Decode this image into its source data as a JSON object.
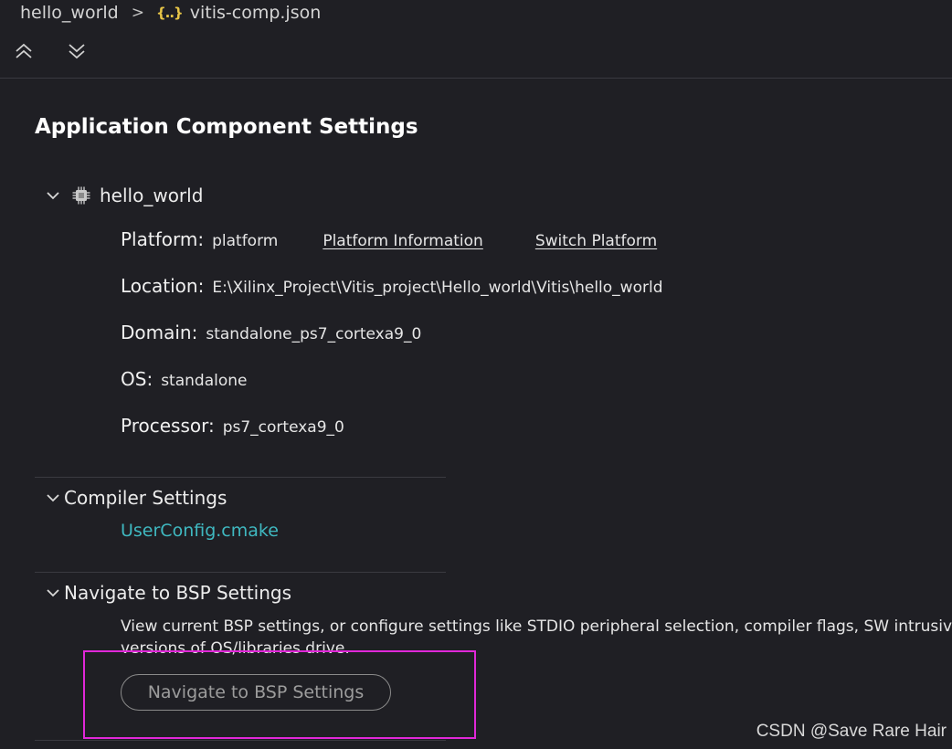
{
  "breadcrumb": {
    "project": "hello_world",
    "separator": ">",
    "file_icon": "{..}",
    "file": "vitis-comp.json"
  },
  "toolbar": {
    "collapse_all_icon": "chevrons-up-icon",
    "expand_all_icon": "chevrons-down-icon"
  },
  "page": {
    "title": "Application Component Settings"
  },
  "component": {
    "name": "hello_world",
    "icon": "chip-icon",
    "properties": {
      "platform": {
        "label": "Platform:",
        "value": "platform",
        "info_link": "Platform Information",
        "switch_link": "Switch Platform"
      },
      "location": {
        "label": "Location:",
        "value": "E:\\Xilinx_Project\\Vitis_project\\Hello_world\\Vitis\\hello_world"
      },
      "domain": {
        "label": "Domain:",
        "value": "standalone_ps7_cortexa9_0"
      },
      "os": {
        "label": "OS:",
        "value": "standalone"
      },
      "processor": {
        "label": "Processor:",
        "value": "ps7_cortexa9_0"
      }
    }
  },
  "compiler_settings": {
    "title": "Compiler Settings",
    "file_link": "UserConfig.cmake"
  },
  "bsp_settings": {
    "title": "Navigate to BSP Settings",
    "description_line1": "View current BSP settings, or configure settings like STDIO peripheral selection, compiler flags, SW intrusive p",
    "description_line2": "versions of OS/libraries drive.",
    "button_label": "Navigate to BSP Settings"
  },
  "annotation": {
    "highlight_color": "#e028d8"
  },
  "watermark": "CSDN @Save Rare Hair",
  "colors": {
    "background": "#1f1f24",
    "link_accent": "#3fb8c0",
    "json_icon": "#e7c547"
  }
}
